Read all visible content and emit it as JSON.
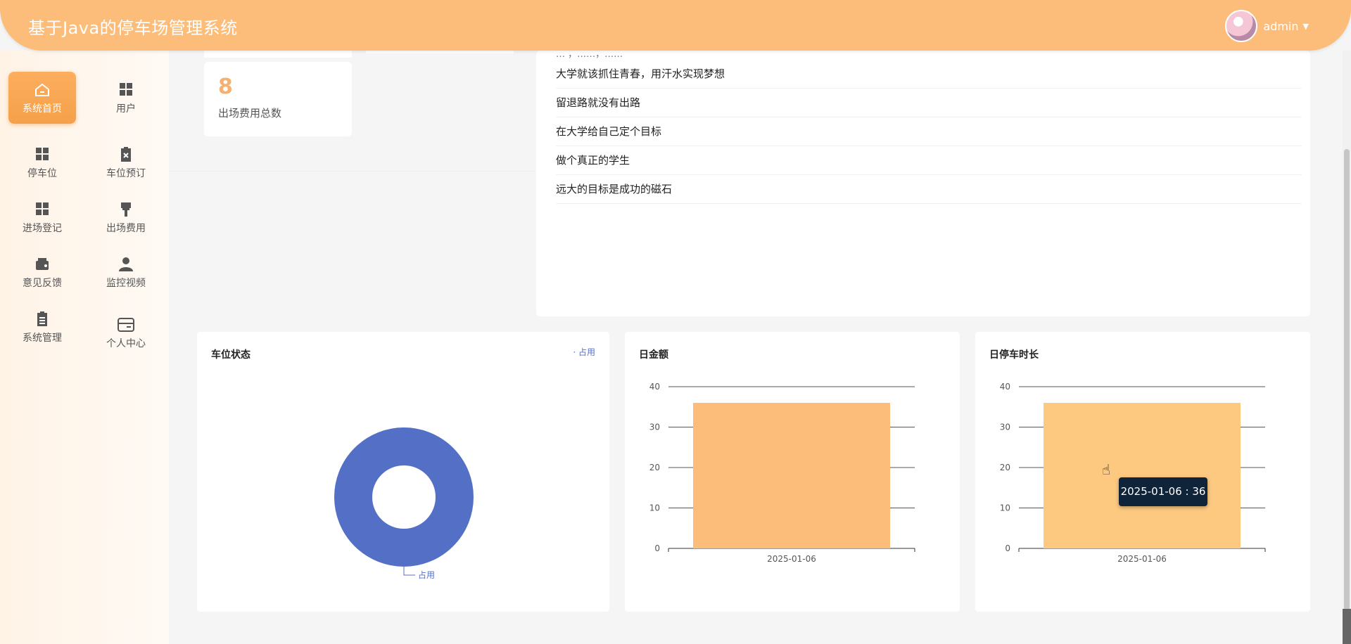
{
  "header": {
    "title": "基于Java的停车场管理系统",
    "user": "admin"
  },
  "sidebar": {
    "items": [
      {
        "label": "系统首页",
        "icon": "home-icon"
      },
      {
        "label": "用户",
        "icon": "grid-icon"
      },
      {
        "label": "停车位",
        "icon": "grid-icon"
      },
      {
        "label": "车位预订",
        "icon": "clipboard-x-icon"
      },
      {
        "label": "进场登记",
        "icon": "grid-icon"
      },
      {
        "label": "出场费用",
        "icon": "brush-icon"
      },
      {
        "label": "意见反馈",
        "icon": "wallet-icon"
      },
      {
        "label": "监控视频",
        "icon": "user-icon"
      },
      {
        "label": "系统管理",
        "icon": "clipboard-icon"
      },
      {
        "label": "个人中心",
        "icon": "card-icon"
      }
    ]
  },
  "stats": {
    "value": "8",
    "label": "出场费用总数"
  },
  "news": {
    "cut_item": "… ，……，……",
    "items": [
      "大学就该抓住青春，用汗水实现梦想",
      "留退路就没有出路",
      "在大学给自己定个目标",
      "做个真正的学生",
      "远大的目标是成功的磁石"
    ]
  },
  "colors": {
    "accent": "#fbbd79",
    "pie": "#5470c6",
    "bar1": "#fbbd79",
    "bar2": "#fdc980"
  },
  "chart_data": [
    {
      "type": "pie",
      "title": "车位状态",
      "legend": [
        "占用"
      ],
      "slices": [
        {
          "name": "占用",
          "value": 1
        }
      ],
      "donut": true
    },
    {
      "type": "bar",
      "title": "日金额",
      "categories": [
        "2025-01-06"
      ],
      "values": [
        36
      ],
      "ylim": [
        0,
        40
      ],
      "yticks": [
        0,
        10,
        20,
        30,
        40
      ]
    },
    {
      "type": "bar",
      "title": "日停车时长",
      "categories": [
        "2025-01-06"
      ],
      "values": [
        36
      ],
      "ylim": [
        0,
        40
      ],
      "yticks": [
        0,
        10,
        20,
        30,
        40
      ],
      "tooltip": "2025-01-06 : 36"
    }
  ]
}
